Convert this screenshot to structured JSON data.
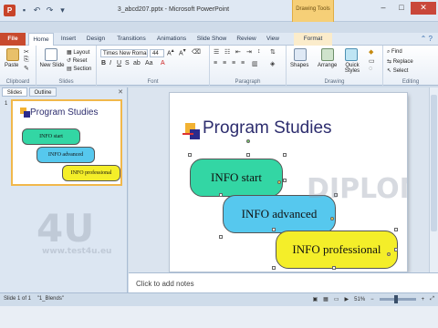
{
  "window": {
    "title": "3_abcd207.pptx - Microsoft PowerPoint",
    "context_tab_header": "Drawing Tools"
  },
  "tabs": [
    "File",
    "Home",
    "Insert",
    "Design",
    "Transitions",
    "Animations",
    "Slide Show",
    "Review",
    "View",
    "Format"
  ],
  "ribbon": {
    "clipboard": {
      "label": "Clipboard",
      "paste": "Paste"
    },
    "slides": {
      "label": "Slides",
      "new_slide": "New Slide",
      "layout": "Layout",
      "reset": "Reset",
      "section": "Section"
    },
    "font": {
      "label": "Font",
      "font_name": "Times New Romai",
      "font_size": "44"
    },
    "paragraph": {
      "label": "Paragraph"
    },
    "drawing": {
      "label": "Drawing",
      "shapes": "Shapes",
      "arrange": "Arrange",
      "quick_styles": "Quick Styles"
    },
    "editing": {
      "label": "Editing",
      "find": "Find",
      "replace": "Replace",
      "select": "Select"
    }
  },
  "left_pane": {
    "tabs": [
      "Slides",
      "Outline"
    ],
    "slide_number": "1"
  },
  "slide": {
    "title": "Program Studies",
    "shapes": [
      "INFO start",
      "INFO advanced",
      "INFO professional"
    ]
  },
  "notes": {
    "placeholder": "Click to add notes"
  },
  "status": {
    "slide_info": "Slide 1 of 1",
    "theme": "\"1_Blends\"",
    "zoom": "51%"
  },
  "watermark": {
    "site": "www.test4u.eu"
  },
  "colors": {
    "shape1": "#33d6a4",
    "shape2": "#56c8ee",
    "shape3": "#f4ee29",
    "file_tab": "#c84a2e",
    "context": "#f6cf77"
  }
}
